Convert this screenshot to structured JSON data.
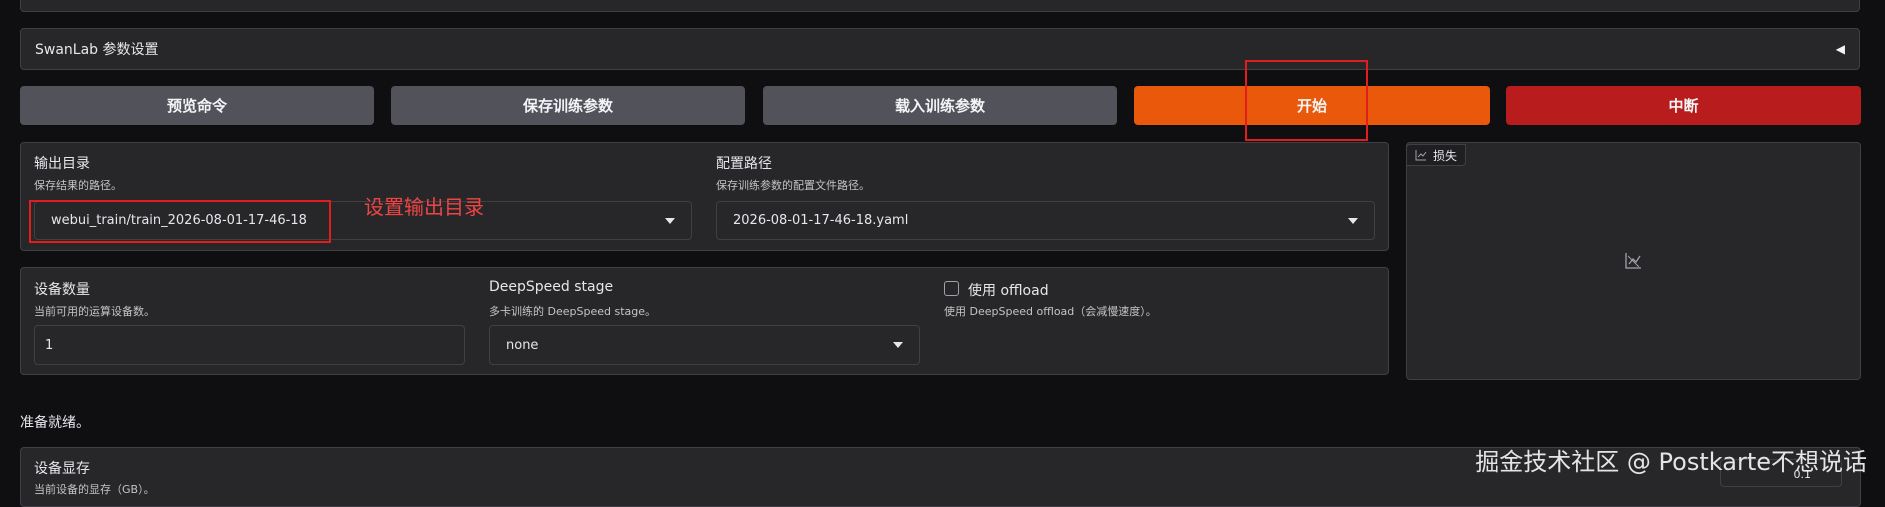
{
  "accordion": {
    "title": "SwanLab 参数设置",
    "arrow": "◀"
  },
  "actions": {
    "preview": "预览命令",
    "save": "保存训练参数",
    "load": "载入训练参数",
    "start": "开始",
    "abort": "中断"
  },
  "output": {
    "dir_label": "输出目录",
    "dir_info": "保存结果的路径。",
    "dir_value": "webui_train/train_2026-08-01-17-46-18",
    "config_label": "配置路径",
    "config_info": "保存训练参数的配置文件路径。",
    "config_value": "2026-08-01-17-46-18.yaml",
    "annotation": "设置输出目录"
  },
  "devices": {
    "count_label": "设备数量",
    "count_info": "当前可用的运算设备数。",
    "count_value": "1",
    "ds_label": "DeepSpeed stage",
    "ds_info": "多卡训练的 DeepSpeed stage。",
    "ds_value": "none",
    "offload_label": "使用 offload",
    "offload_info": "使用 DeepSpeed offload（会减慢速度）。",
    "offload_checked": false
  },
  "plot": {
    "tag_label": "损失",
    "icon": "chart-icon"
  },
  "status": {
    "text": "准备就绪。"
  },
  "memory": {
    "label": "设备显存",
    "info": "当前设备的显存（GB）。",
    "value": "0.1"
  },
  "watermark": "掘金技术社区 @ Postkarte不想说话",
  "colors": {
    "background": "#0f0f11",
    "panel": "#27272a",
    "start": "#ea580c",
    "abort": "#b91c1c",
    "annotation": "#e11d1d"
  }
}
